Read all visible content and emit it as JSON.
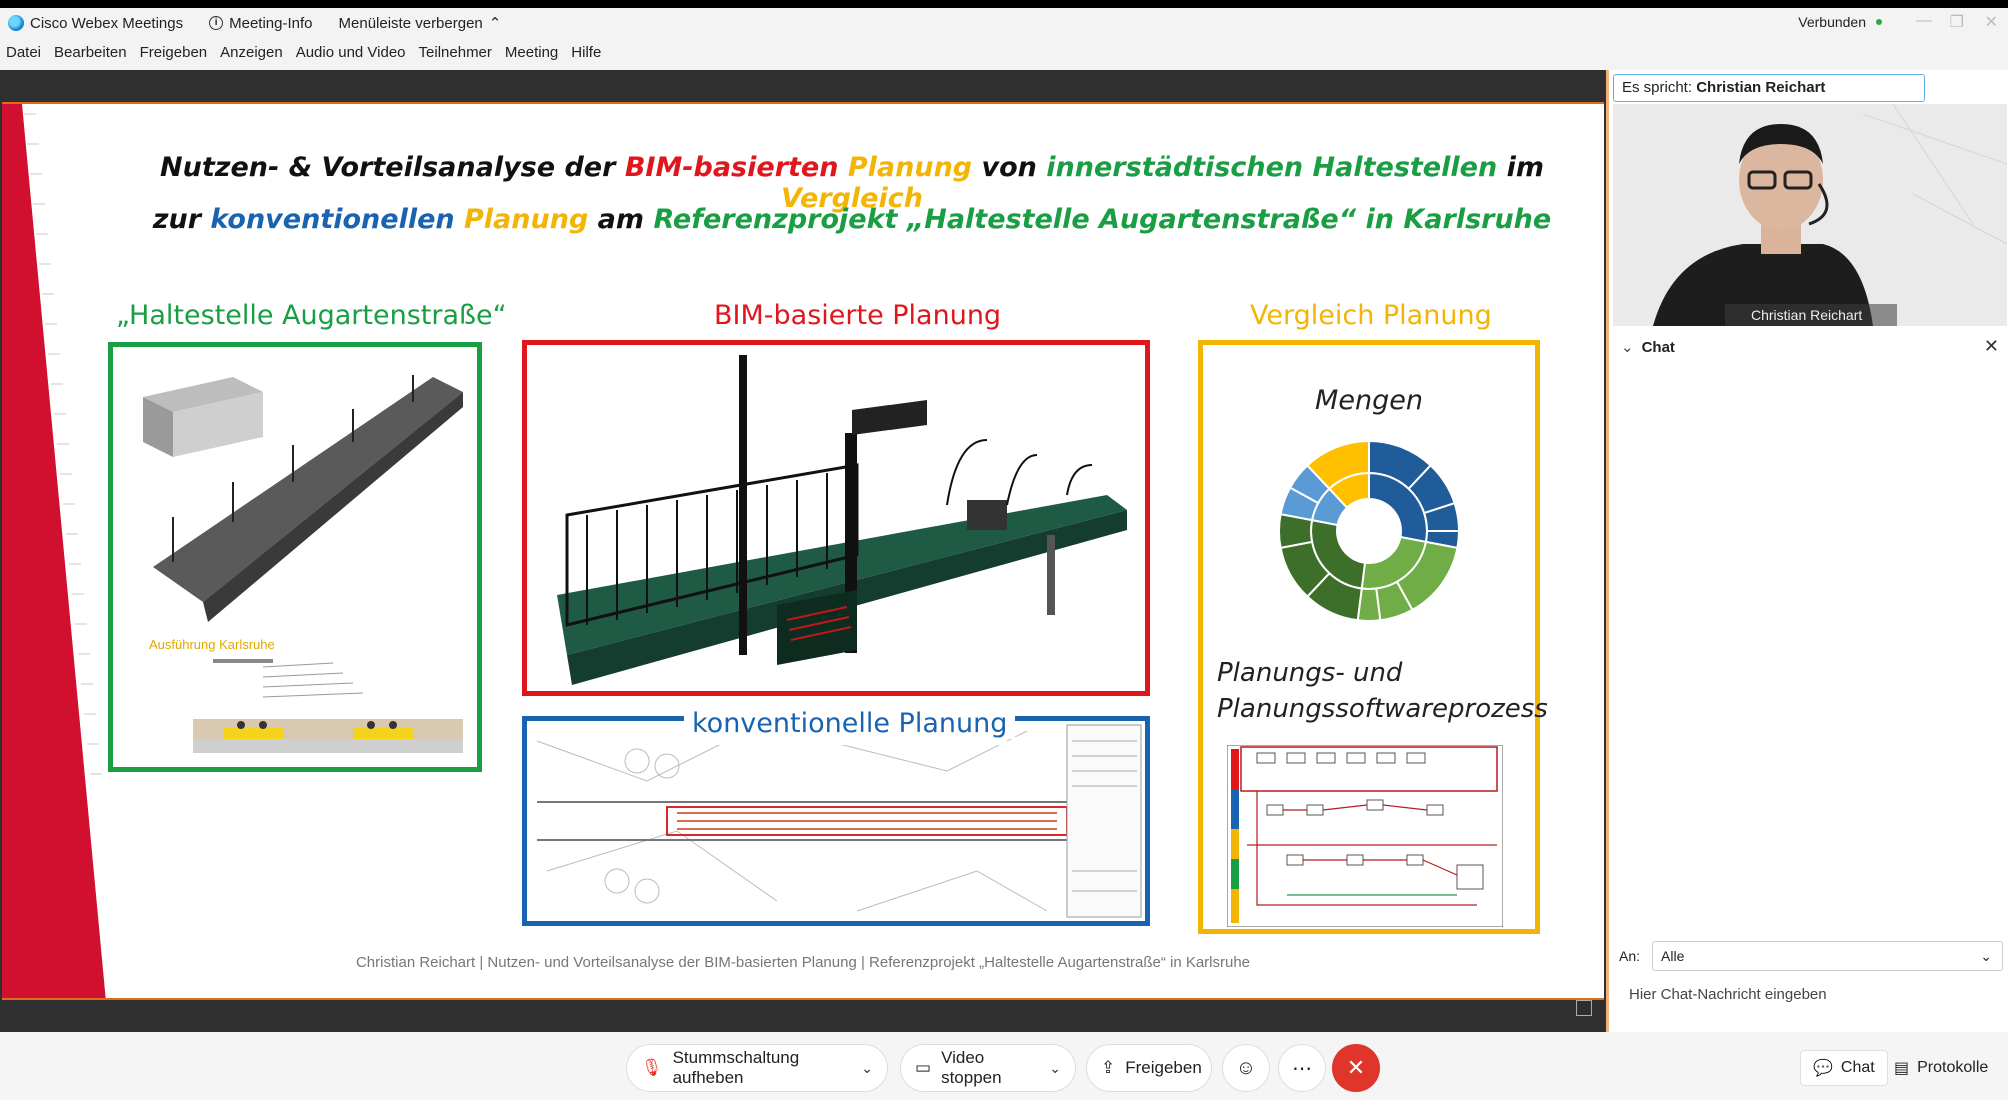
{
  "app": {
    "title": "Cisco Webex Meetings",
    "meeting_info": "Meeting-Info",
    "hide_menu": "Menüleiste verbergen",
    "status": "Verbunden"
  },
  "menu": [
    "Datei",
    "Bearbeiten",
    "Freigeben",
    "Anzeigen",
    "Audio und Video",
    "Teilnehmer",
    "Meeting",
    "Hilfe"
  ],
  "slide": {
    "title_line1": [
      {
        "text": "Nutzen- & Vorteilsanalyse der ",
        "color": "black"
      },
      {
        "text": "BIM-basierten",
        "color": "red"
      },
      {
        "text": " ",
        "color": "black"
      },
      {
        "text": "Planung",
        "color": "yellow"
      },
      {
        "text": " von ",
        "color": "black"
      },
      {
        "text": "innerstädtischen Haltestellen",
        "color": "green"
      },
      {
        "text": " im ",
        "color": "black"
      },
      {
        "text": "Vergleich",
        "color": "yellow"
      }
    ],
    "title_line2": [
      {
        "text": "zur ",
        "color": "black"
      },
      {
        "text": "konventionellen",
        "color": "blue"
      },
      {
        "text": " ",
        "color": "black"
      },
      {
        "text": "Planung",
        "color": "yellow"
      },
      {
        "text": " am ",
        "color": "black"
      },
      {
        "text": "Referenzprojekt „Haltestelle Augartenstraße“ in Karlsruhe",
        "color": "green"
      }
    ],
    "heading_station": "„Haltestelle Augartenstraße“",
    "heading_bim": "BIM-basierte Planung",
    "heading_compare": "Vergleich Planung",
    "heading_conventional": "konventionelle Planung",
    "execution_label": "Ausführung Karlsruhe",
    "quantities_label": "Mengen",
    "process_label_1": "Planungs- und",
    "process_label_2": "Planungssoftwareprozess",
    "footer": "Christian Reichart | Nutzen- und Vorteilsanalyse der BIM-basierten Planung | Referenzprojekt „Haltestelle Augartenstraße“ in Karlsruhe",
    "colors": {
      "red": "#e0161d",
      "yellow": "#f2b505",
      "green": "#1a9e44",
      "blue": "#1a63b0"
    }
  },
  "panel": {
    "speaking_prefix": "Es spricht:",
    "speaking_name": "Christian Reichart",
    "video_name": "Christian Reichart",
    "chat_title": "Chat",
    "to_label": "An:",
    "to_value": "Alle",
    "chat_placeholder": "Hier Chat-Nachricht eingeben"
  },
  "controls": {
    "unmute": "Stummschaltung aufheben",
    "stop_video": "Video stoppen",
    "share": "Freigeben",
    "chat": "Chat",
    "logs": "Protokolle"
  },
  "icons": [
    "webex-logo-icon",
    "info-icon",
    "chevron-up-icon",
    "microphone-muted-icon",
    "video-camera-icon",
    "share-icon",
    "emoji-icon",
    "more-icon",
    "end-call-icon",
    "chat-icon",
    "logs-icon",
    "close-icon"
  ]
}
